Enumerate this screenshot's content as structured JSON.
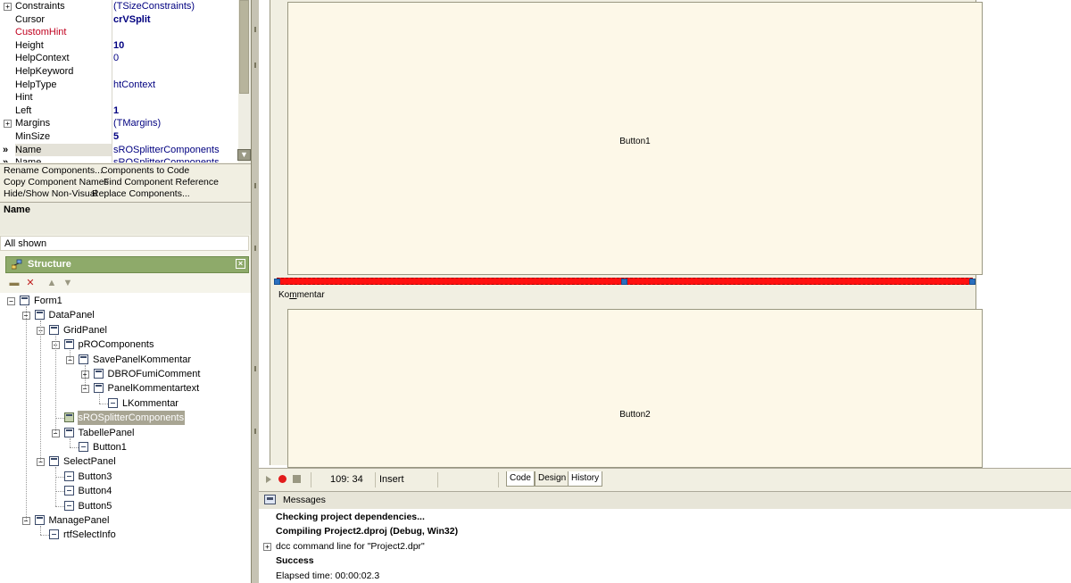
{
  "object_inspector": {
    "properties": [
      {
        "name": "Constraints",
        "value": "(TSizeConstraints)",
        "expandable": true
      },
      {
        "name": "Cursor",
        "value": "crVSplit",
        "bold": true
      },
      {
        "name": "CustomHint",
        "value": "",
        "red": true
      },
      {
        "name": "Height",
        "value": "10",
        "bold": true
      },
      {
        "name": "HelpContext",
        "value": "0"
      },
      {
        "name": "HelpKeyword",
        "value": ""
      },
      {
        "name": "HelpType",
        "value": "htContext"
      },
      {
        "name": "Hint",
        "value": ""
      },
      {
        "name": "Left",
        "value": "1",
        "bold": true
      },
      {
        "name": "Margins",
        "value": "(TMargins)",
        "expandable": true
      },
      {
        "name": "MinSize",
        "value": "5",
        "bold": true
      },
      {
        "name": "Name",
        "value": "sROSplitterComponents",
        "selected": true
      }
    ],
    "partial_row": {
      "name": "Name",
      "value": "sROSplitterComponents"
    },
    "links": [
      [
        "Rename Components...",
        "Components to Code"
      ],
      [
        "Copy Component Names",
        "Find Component Reference"
      ],
      [
        "Hide/Show Non-Visual",
        "Replace Components..."
      ]
    ],
    "description_title": "Name",
    "status": "All shown"
  },
  "structure": {
    "title": "Structure",
    "tree": [
      {
        "label": "Form1",
        "level": 0,
        "exp": "-",
        "icon": "form"
      },
      {
        "label": "DataPanel",
        "level": 1,
        "exp": "-",
        "icon": "panel"
      },
      {
        "label": "GridPanel",
        "level": 2,
        "exp": "-",
        "icon": "panel"
      },
      {
        "label": "pROComponents",
        "level": 3,
        "exp": "-",
        "icon": "panel"
      },
      {
        "label": "SavePanelKommentar",
        "level": 4,
        "exp": "-",
        "icon": "panel"
      },
      {
        "label": "DBROFumiComment",
        "level": 5,
        "exp": "+",
        "icon": "panel"
      },
      {
        "label": "PanelKommentartext",
        "level": 5,
        "exp": "-",
        "icon": "panel"
      },
      {
        "label": "LKommentar",
        "level": 6,
        "exp": "",
        "icon": "btn"
      },
      {
        "label": "sROSplitterComponents",
        "level": 3,
        "exp": "",
        "icon": "split",
        "selected": true
      },
      {
        "label": "TabellePanel",
        "level": 3,
        "exp": "-",
        "icon": "panel"
      },
      {
        "label": "Button1",
        "level": 4,
        "exp": "",
        "icon": "btn"
      },
      {
        "label": "SelectPanel",
        "level": 2,
        "exp": "-",
        "icon": "panel"
      },
      {
        "label": "Button3",
        "level": 3,
        "exp": "",
        "icon": "btn"
      },
      {
        "label": "Button4",
        "level": 3,
        "exp": "",
        "icon": "btn"
      },
      {
        "label": "Button5",
        "level": 3,
        "exp": "",
        "icon": "btn"
      },
      {
        "label": "ManagePanel",
        "level": 1,
        "exp": "-",
        "icon": "panel"
      },
      {
        "label": "rtfSelectInfo",
        "level": 2,
        "exp": "",
        "icon": "btn"
      }
    ]
  },
  "designer": {
    "button1": "Button1",
    "label_pre": "Ko",
    "label_ul": "m",
    "label_post": "mentar",
    "button2": "Button2"
  },
  "editor_bar": {
    "position": "109: 34",
    "mode": "Insert",
    "tabs": [
      "Code",
      "Design",
      "History"
    ],
    "active_tab": "Design"
  },
  "messages": {
    "title": "Messages",
    "lines": [
      {
        "text": "Checking project dependencies...",
        "bold": true
      },
      {
        "text": "Compiling Project2.dproj (Debug, Win32)",
        "bold": true
      },
      {
        "text": "dcc command line for \"Project2.dpr\"",
        "bold": false,
        "expandable": true
      },
      {
        "text": "Success",
        "bold": true
      },
      {
        "text": "Elapsed time: 00:00:02.3",
        "bold": false
      }
    ]
  },
  "colors": {
    "splitter": "#ff1010",
    "structure_header": "#8eaa6a",
    "tree_selection": "#a8a593"
  }
}
